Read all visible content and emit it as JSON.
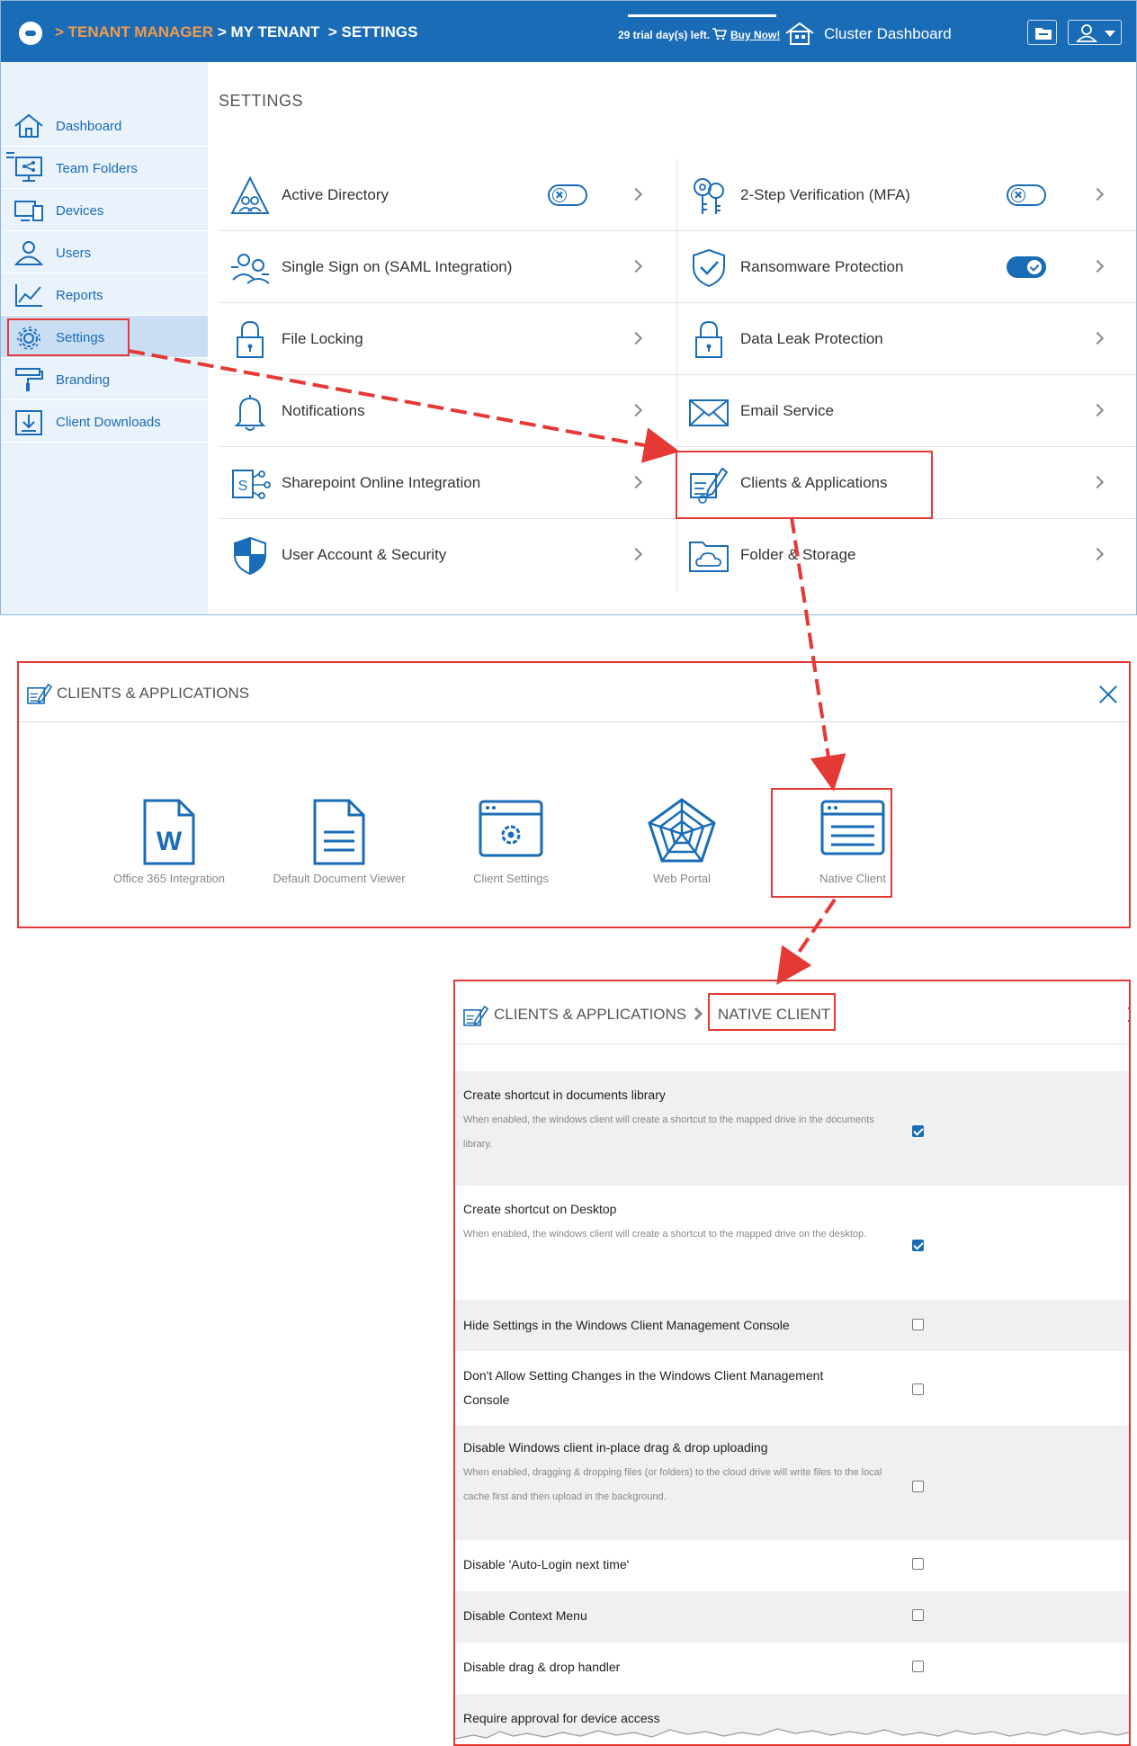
{
  "topbar": {
    "breadcrumb": [
      {
        "text": "> TENANT MANAGER",
        "color": "orange"
      },
      {
        "text": " > MY TENANT",
        "color": "white"
      },
      {
        "text": "  > SETTINGS",
        "color": "white"
      }
    ],
    "trial_text": "29 trial day(s) left.",
    "buy_now": "Buy Now!",
    "cluster_dashboard": "Cluster Dashboard"
  },
  "sidebar": {
    "items": [
      {
        "label": "Dashboard",
        "icon": "home-icon"
      },
      {
        "label": "Team Folders",
        "icon": "team-folders-icon"
      },
      {
        "label": "Devices",
        "icon": "devices-icon"
      },
      {
        "label": "Users",
        "icon": "users-icon"
      },
      {
        "label": "Reports",
        "icon": "reports-icon"
      },
      {
        "label": "Settings",
        "icon": "gear-icon",
        "active": true
      },
      {
        "label": "Branding",
        "icon": "paint-roller-icon"
      },
      {
        "label": "Client Downloads",
        "icon": "download-icon"
      }
    ]
  },
  "settings": {
    "title": "SETTINGS",
    "left": [
      {
        "label": "Active Directory",
        "icon": "active-directory-icon",
        "toggle": "off"
      },
      {
        "label": "Single Sign on (SAML Integration)",
        "icon": "sso-icon"
      },
      {
        "label": "File Locking",
        "icon": "lock-icon"
      },
      {
        "label": "Notifications",
        "icon": "bell-icon"
      },
      {
        "label": "Sharepoint Online Integration",
        "icon": "sharepoint-icon"
      },
      {
        "label": "User Account & Security",
        "icon": "shield-icon"
      }
    ],
    "right": [
      {
        "label": "2-Step Verification (MFA)",
        "icon": "keys-icon",
        "toggle": "off"
      },
      {
        "label": "Ransomware Protection",
        "icon": "shield-check-icon",
        "toggle": "on"
      },
      {
        "label": "Data Leak Protection",
        "icon": "lock-icon"
      },
      {
        "label": "Email Service",
        "icon": "envelope-icon"
      },
      {
        "label": "Clients & Applications",
        "icon": "clients-apps-icon"
      },
      {
        "label": "Folder & Storage",
        "icon": "folder-cloud-icon"
      }
    ]
  },
  "clients_panel": {
    "title": "CLIENTS & APPLICATIONS",
    "tiles": [
      {
        "label": "Office 365 Integration",
        "icon": "word-doc-icon"
      },
      {
        "label": "Default Document Viewer",
        "icon": "document-icon"
      },
      {
        "label": "Client Settings",
        "icon": "client-settings-icon"
      },
      {
        "label": "Web Portal",
        "icon": "web-portal-icon"
      },
      {
        "label": "Native Client",
        "icon": "native-client-icon"
      }
    ]
  },
  "native_panel": {
    "crumb1": "CLIENTS & APPLICATIONS",
    "crumb2": "NATIVE CLIENT",
    "options": [
      {
        "title": "Create shortcut in documents library",
        "desc": "When enabled, the windows client will create a shortcut to the mapped drive in the documents library.",
        "checked": true
      },
      {
        "title": "Create shortcut on Desktop",
        "desc": "When enabled, the windows client will create a shortcut to the mapped drive on the desktop.",
        "checked": true
      },
      {
        "title": "Hide Settings in the Windows Client Management Console",
        "desc": "",
        "checked": false
      },
      {
        "title": "Don't Allow Setting Changes in the Windows Client Management Console",
        "desc": "",
        "checked": false
      },
      {
        "title": "Disable Windows client in-place drag & drop uploading",
        "desc": "When enabled, dragging & dropping files (or folders) to the cloud drive will write files to the local cache first and then upload in the background.",
        "checked": false
      },
      {
        "title": "Disable 'Auto-Login next time'",
        "desc": "",
        "checked": false
      },
      {
        "title": "Disable Context Menu",
        "desc": "",
        "checked": false
      },
      {
        "title": "Disable drag & drop handler",
        "desc": "",
        "checked": false
      },
      {
        "title": "Require approval for device access",
        "desc": "",
        "checked": false
      }
    ]
  },
  "colors": {
    "brand_blue": "#1a6cb7",
    "highlight_red": "#e53935",
    "breadcrumb_orange": "#f29b4b"
  }
}
